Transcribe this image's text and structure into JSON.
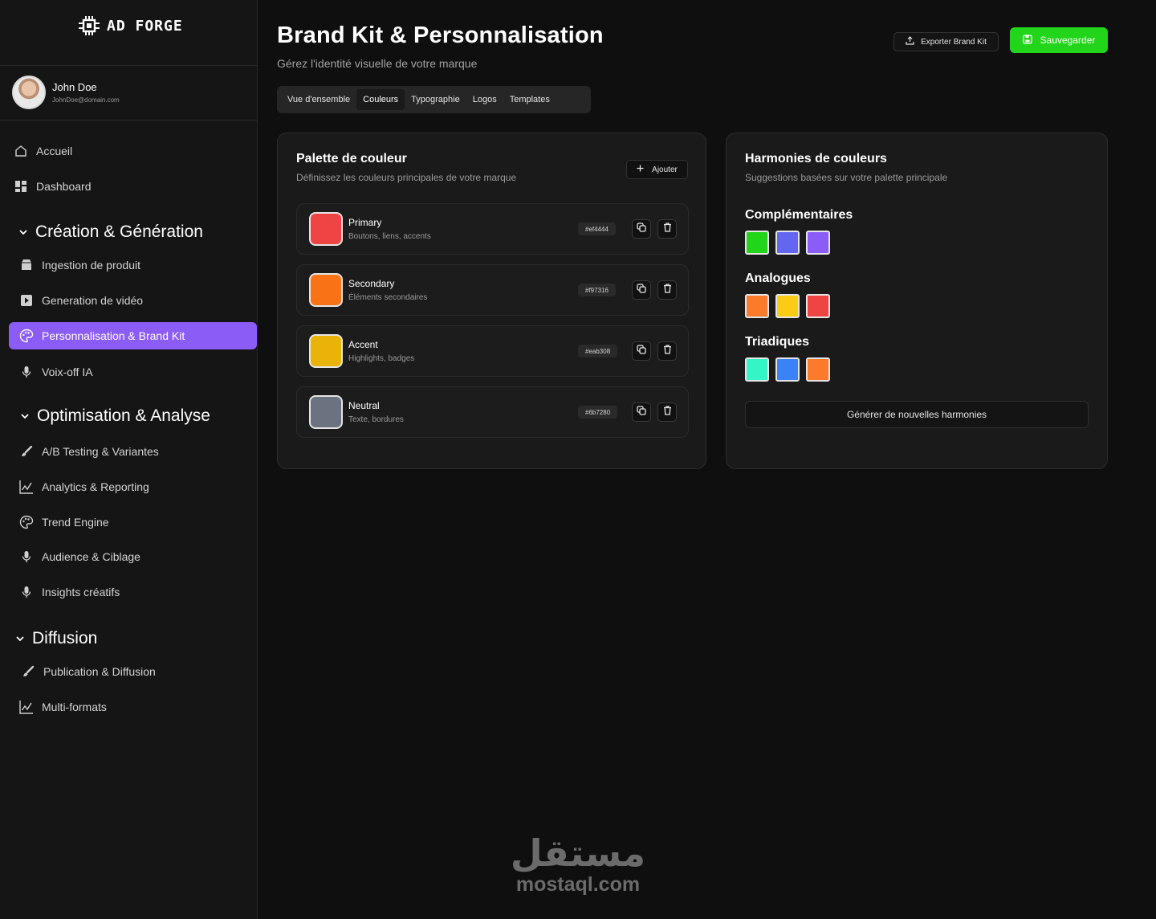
{
  "app": {
    "logo_text": "AD FORGE"
  },
  "user": {
    "name": "John Doe",
    "email": "JohnDoe@domain.com"
  },
  "sidebar": {
    "top_items": [
      {
        "label": "Accueil",
        "icon": "home-icon"
      },
      {
        "label": "Dashboard",
        "icon": "dashboard-icon"
      }
    ],
    "sections": [
      {
        "title": "Création & Génération",
        "items": [
          {
            "label": "Ingestion de produit",
            "icon": "box-icon"
          },
          {
            "label": "Generation de vidéo",
            "icon": "play-icon"
          },
          {
            "label": "Personnalisation & Brand Kit",
            "icon": "palette-icon",
            "active": true
          },
          {
            "label": "Voix-off IA",
            "icon": "microphone-icon"
          }
        ]
      },
      {
        "title": "Optimisation & Analyse",
        "items": [
          {
            "label": "A/B Testing & Variantes",
            "icon": "brush-icon"
          },
          {
            "label": "Analytics & Reporting",
            "icon": "chart-icon"
          },
          {
            "label": "Trend Engine",
            "icon": "palette-icon"
          },
          {
            "label": "Audience & Ciblage",
            "icon": "microphone-icon"
          },
          {
            "label": "Insights créatifs",
            "icon": "microphone-icon"
          }
        ]
      },
      {
        "title": "Diffusion",
        "items": [
          {
            "label": "Publication & Diffusion",
            "icon": "brush-icon"
          },
          {
            "label": "Multi-formats",
            "icon": "chart-icon"
          }
        ]
      }
    ]
  },
  "header": {
    "title": "Brand Kit & Personnalisation",
    "subtitle": "Gérez l'identité visuelle de votre marque",
    "export_label": "Exporter Brand Kit",
    "save_label": "Sauvegarder"
  },
  "tabs": [
    {
      "label": "Vue d'ensemble"
    },
    {
      "label": "Couleurs",
      "active": true
    },
    {
      "label": "Typographie"
    },
    {
      "label": "Logos"
    },
    {
      "label": "Templates"
    }
  ],
  "palette": {
    "title": "Palette de couleur",
    "subtitle": "Définissez les couleurs principales de votre marque",
    "add_label": "Ajouter",
    "colors": [
      {
        "name": "Primary",
        "desc": "Boutons, liens, accents",
        "hex": "#ef4444"
      },
      {
        "name": "Secondary",
        "desc": "Éléments secondaires",
        "hex": "#f97316"
      },
      {
        "name": "Accent",
        "desc": "Highlights, badges",
        "hex": "#eab308"
      },
      {
        "name": "Neutral",
        "desc": "Texte, bordures",
        "hex": "#6b7280"
      }
    ]
  },
  "harmonies": {
    "title": "Harmonies de couleurs",
    "subtitle": "Suggestions basées sur votre palette principale",
    "groups": [
      {
        "label": "Complémentaires",
        "colors": [
          "#22d41a",
          "#6366f1",
          "#8b5cf6"
        ]
      },
      {
        "label": "Analogues",
        "colors": [
          "#fb7a2c",
          "#facc15",
          "#ef4444"
        ]
      },
      {
        "label": "Triadiques",
        "colors": [
          "#34f5c5",
          "#3b82f6",
          "#fb7a2c"
        ]
      }
    ],
    "generate_label": "Générer de nouvelles harmonies"
  },
  "watermark": {
    "arabic": "مستقل",
    "latin": "mostaql.com"
  }
}
